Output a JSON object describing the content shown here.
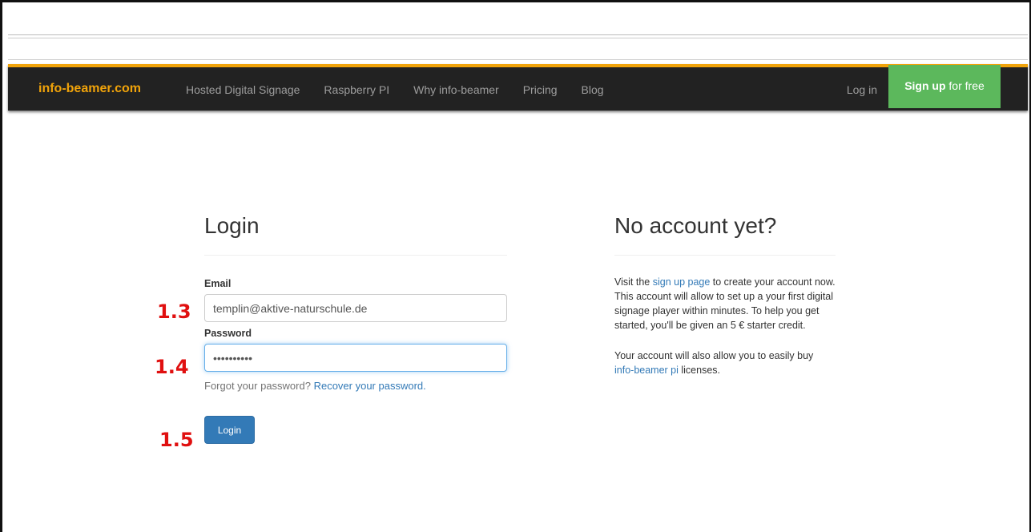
{
  "navbar": {
    "brand": "info-beamer.com",
    "links": [
      "Hosted Digital Signage",
      "Raspberry PI",
      "Why info-beamer",
      "Pricing",
      "Blog"
    ],
    "login": "Log in",
    "signup_bold": "Sign up",
    "signup_rest": " for free",
    "accent_color": "#f0a30a",
    "signup_color": "#5cb85c"
  },
  "login": {
    "title": "Login",
    "email_label": "Email",
    "email_value": "templin@aktive-naturschule.de",
    "password_label": "Password",
    "password_value": "1234567890",
    "forgot_text": "Forgot your password? ",
    "forgot_link": "Recover your password.",
    "button": "Login"
  },
  "signup_info": {
    "title": "No account yet?",
    "p1_before": "Visit the ",
    "p1_link": "sign up page",
    "p1_after": " to create your account now. This account will allow to set up a your first digital signage player within minutes. To help you get started, you'll be given an 5 € starter credit.",
    "p2_before": "Your account will also allow you to easily buy ",
    "p2_link": "info-beamer pi",
    "p2_after": " licenses."
  },
  "annotations": {
    "email": "1.3",
    "password": "1.4",
    "button": "1.5"
  }
}
